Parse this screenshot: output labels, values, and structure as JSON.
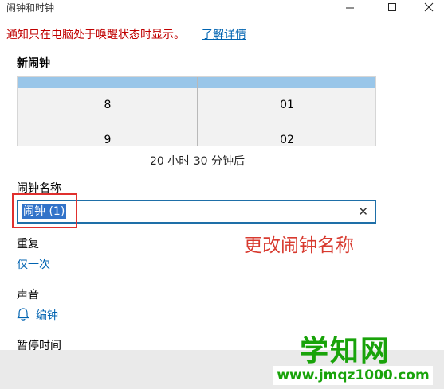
{
  "window": {
    "title": "闹钟和时钟",
    "minimize_icon": "minimize-icon",
    "maximize_icon": "maximize-icon",
    "close_icon": "close-icon"
  },
  "notice": {
    "text": "通知只在电脑处于唤醒状态时显示。",
    "link": "了解详情",
    "color": "#c00000"
  },
  "new_alarm": {
    "heading": "新闹钟",
    "hour_values": [
      "8",
      "9"
    ],
    "minute_values": [
      "01",
      "02"
    ],
    "duration": "20 小时 30 分钟后"
  },
  "alarm_name": {
    "label": "闹钟名称",
    "value": "闹钟 (1)",
    "clear_icon": "clear-icon"
  },
  "annotation": {
    "text": "更改闹钟名称",
    "color": "#d83a2f"
  },
  "repeat": {
    "label": "重复",
    "value": "仅一次"
  },
  "sound": {
    "label": "声音",
    "value": "编钟",
    "icon": "bell-icon"
  },
  "snooze": {
    "label": "暂停时间"
  },
  "watermark": {
    "text": "学知网",
    "url": "www.jmqz1000.com",
    "color": "#19a30a"
  },
  "accent": "#0063b1"
}
